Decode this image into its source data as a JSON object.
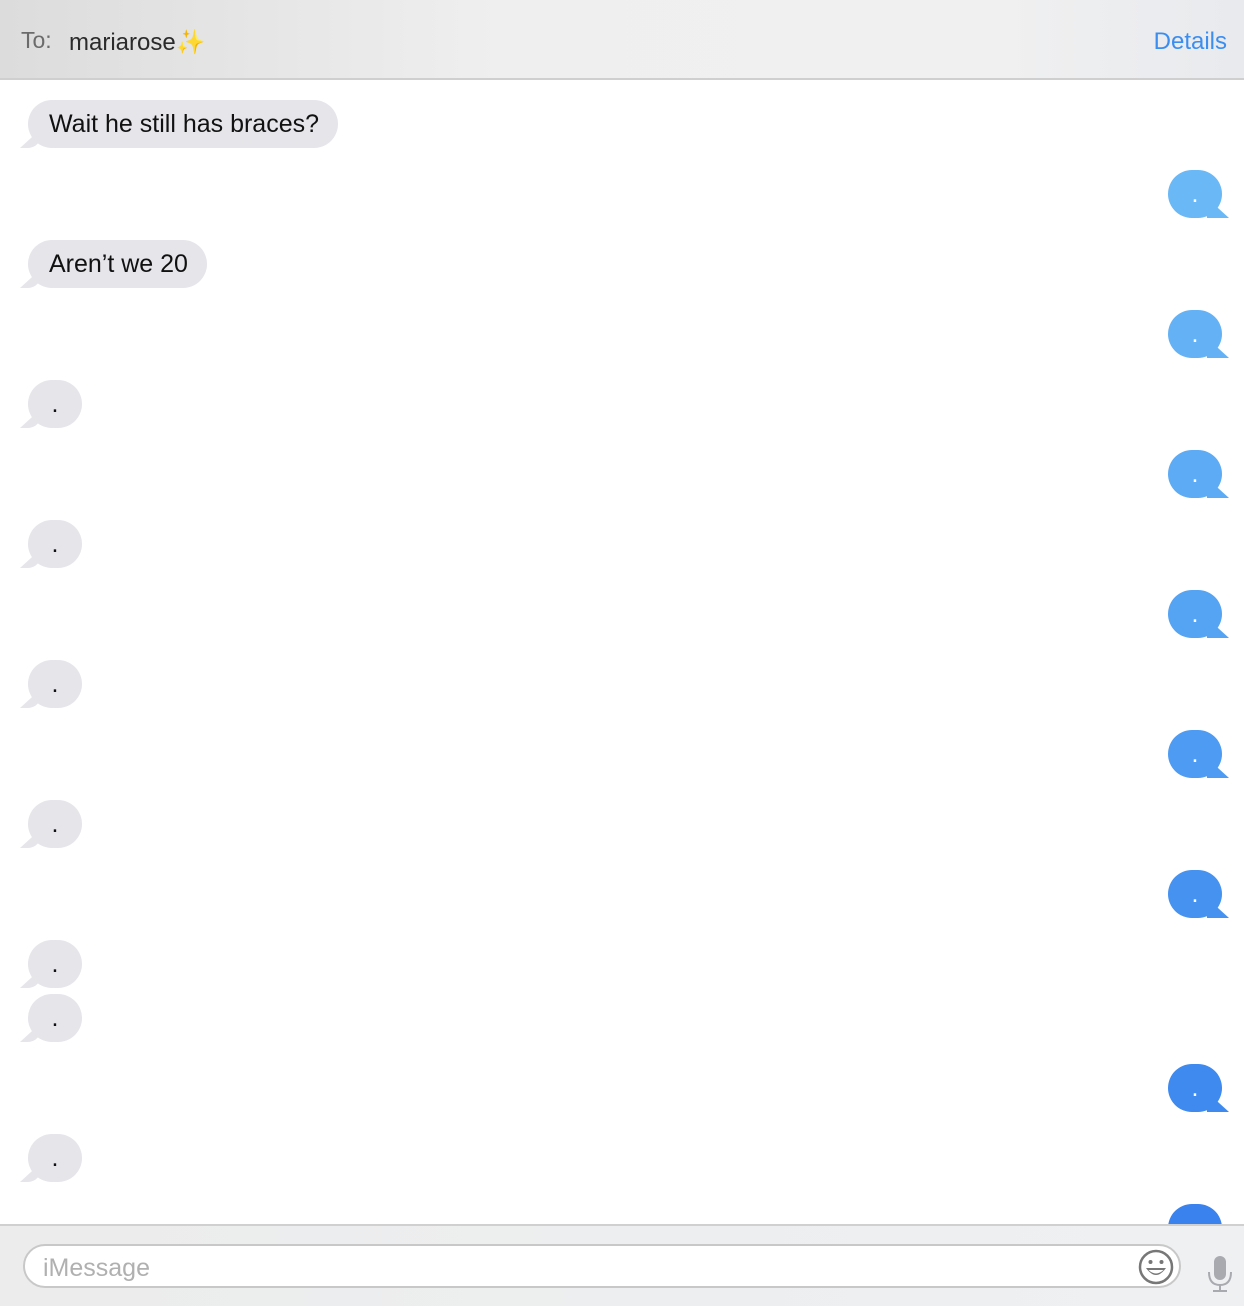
{
  "header": {
    "to_label": "To:",
    "recipient": "mariarose",
    "recipient_emoji": "✨",
    "details_label": "Details"
  },
  "messages": [
    {
      "dir": "in",
      "text": "Wait he still has braces?"
    },
    {
      "dir": "out",
      "text": "."
    },
    {
      "dir": "in",
      "text": "Aren’t we 20"
    },
    {
      "dir": "out",
      "text": "."
    },
    {
      "dir": "in",
      "text": "."
    },
    {
      "dir": "out",
      "text": "."
    },
    {
      "dir": "in",
      "text": "."
    },
    {
      "dir": "out",
      "text": "."
    },
    {
      "dir": "in",
      "text": "."
    },
    {
      "dir": "out",
      "text": "."
    },
    {
      "dir": "in",
      "text": "."
    },
    {
      "dir": "out",
      "text": "."
    },
    {
      "dir": "in",
      "text": "."
    },
    {
      "dir": "in",
      "text": "."
    },
    {
      "dir": "out",
      "text": "."
    },
    {
      "dir": "in",
      "text": "."
    },
    {
      "dir": "out",
      "text": ""
    }
  ],
  "composer": {
    "placeholder": "iMessage",
    "emoji_icon": "smiley-icon",
    "mic_icon": "microphone-icon"
  },
  "colors": {
    "accent": "#3b8ef0",
    "incoming": "#e5e5ea",
    "outgoing_top": "#6ab8f6",
    "outgoing_bottom": "#3a82ee"
  }
}
